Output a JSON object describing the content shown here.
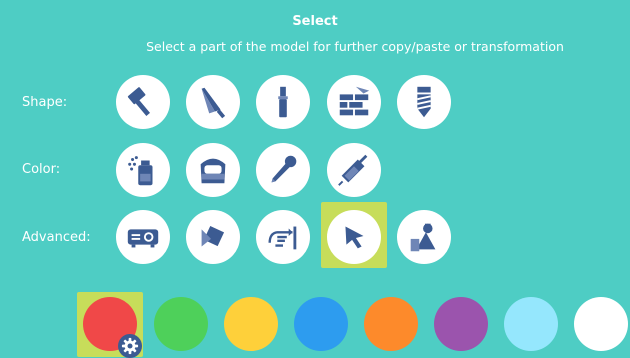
{
  "header": {
    "title": "Select",
    "subtitle": "Select a part of the model for further copy/paste or transformation"
  },
  "rows": [
    {
      "label": "Shape:",
      "tools": [
        "hammer-icon",
        "trowel-icon",
        "chisel-icon",
        "brick-wall-icon",
        "drill-icon"
      ]
    },
    {
      "label": "Color:",
      "tools": [
        "spray-can-icon",
        "paint-bucket-icon",
        "dropper-icon",
        "syringe-icon"
      ]
    },
    {
      "label": "Advanced:",
      "tools": [
        "projector-icon",
        "rotate-shape-icon",
        "hand-pointer-icon",
        "select-arrow-icon",
        "shapes-icon"
      ]
    }
  ],
  "selected_tool": "select-arrow-icon",
  "palette": {
    "colors": [
      "#f04848",
      "#4ed05a",
      "#fed03a",
      "#2d9cef",
      "#fd8a2b",
      "#9b54ad",
      "#95e7fd",
      "#ffffff"
    ],
    "selected_index": 0,
    "highlight_color": "#c7dd5a",
    "icon_color": "#3c5b92"
  }
}
